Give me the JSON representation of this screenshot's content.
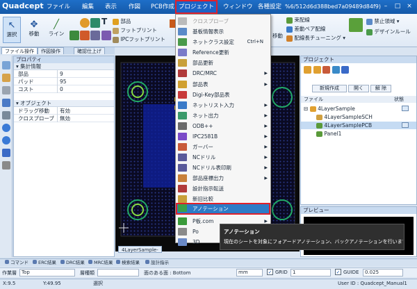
{
  "app": {
    "logo": "Quadcept",
    "url_fragment": "%6/512d6d388bed7a09489d84f9)",
    "user": "User ID : Quadcept_Manual1"
  },
  "menubar": [
    {
      "label": "ファイル"
    },
    {
      "label": "編集"
    },
    {
      "label": "表示"
    },
    {
      "label": "作図"
    },
    {
      "label": "PCB作成"
    },
    {
      "label": "プロジェクト"
    },
    {
      "label": "ウィンドウ"
    },
    {
      "label": "各種設定"
    }
  ],
  "ribbon": {
    "select": "選択",
    "move": "移動",
    "line": "ライン",
    "part": "部品",
    "footprint": "フットプリント",
    "ipc_footprint": "IPCフットプリント",
    "right_move": "移動",
    "bundle": "束配線",
    "diff_pair": "差動ペア配線",
    "wire_tune": "配線長チューニング",
    "no_wire": "禁止領域",
    "design_rule": "デザインルール"
  },
  "panel_tabs": {
    "file_ops": "ファイル操作",
    "draw_ops": "作図操作",
    "check": "確認仕上げ"
  },
  "properties": {
    "title": "プロパティ",
    "sections": [
      {
        "name": "集計情報",
        "rows": [
          {
            "k": "部品",
            "v": "9"
          },
          {
            "k": "パッド",
            "v": "95"
          },
          {
            "k": "コスト",
            "v": "0"
          }
        ]
      },
      {
        "name": "オブジェクト",
        "rows": [
          {
            "k": "ドラッグ移動",
            "v": "有効"
          },
          {
            "k": "クロスプローブ",
            "v": "無効"
          }
        ]
      }
    ]
  },
  "dropdown": [
    {
      "label": "クロスプローブ",
      "disabled": true
    },
    {
      "label": "基板情報表示"
    },
    {
      "label": "ネットクラス設定",
      "shortcut": "Ctrl+N"
    },
    {
      "label": "Reference更新"
    },
    {
      "label": "部品更新"
    },
    {
      "label": "DRC/MRC",
      "sub": true
    },
    {
      "label": "部品表",
      "sub": true
    },
    {
      "label": "Digi-Key部品表"
    },
    {
      "label": "ネットリスト入力",
      "sub": true
    },
    {
      "label": "ネット出力",
      "sub": true
    },
    {
      "label": "ODB++",
      "sub": true
    },
    {
      "label": "IPC2581B",
      "sub": true
    },
    {
      "label": "ガーバー",
      "sub": true
    },
    {
      "label": "NCドリル",
      "sub": true
    },
    {
      "label": "NCドリル表印刷",
      "sub": true
    },
    {
      "label": "部品座標出力",
      "sub": true
    },
    {
      "label": "設計指示転送"
    },
    {
      "label": "新旧比較"
    },
    {
      "label": "アノテーション",
      "highlight": true
    },
    {
      "label": "P板.com",
      "sub": true
    },
    {
      "label": "Po"
    },
    {
      "label": "3D"
    }
  ],
  "tooltip": {
    "title": "アノテーション",
    "body": "現在のシートを対象にフォアードアノテーション、バックアノテーションを行います。"
  },
  "project": {
    "title": "プロジェクト",
    "new_btn": "新規作成",
    "open_btn": "開く",
    "close_btn": "解 除",
    "col_file": "ファイル",
    "col_status": "状態",
    "items": [
      "4LayerSample",
      "4LayerSampleSCH",
      "4LayerSamplePCB",
      "Panel1"
    ]
  },
  "preview": {
    "title": "プレビュー"
  },
  "canvas_tab": "4LayerSample-",
  "bottom_tabs": [
    "コマンド",
    "ERC結果",
    "DRC結果",
    "MRC結果",
    "検索結果",
    "設計指示"
  ],
  "toolbar2": {
    "layer_label": "作業層",
    "layer_value": "Top",
    "outline_label": "層種類",
    "face_label": "面のある面 : Bottom",
    "unit": "mm",
    "grid_label": "GRID",
    "grid_value": "1",
    "guide_label": "GUIDE",
    "guide_value": "0.025"
  },
  "status": {
    "x": "X:9.5",
    "y": "Y:49.95",
    "mode": "選択"
  },
  "colors": {
    "accent": "#1559a8",
    "highlight": "#2d7bc7",
    "outline": "#e0202a"
  }
}
